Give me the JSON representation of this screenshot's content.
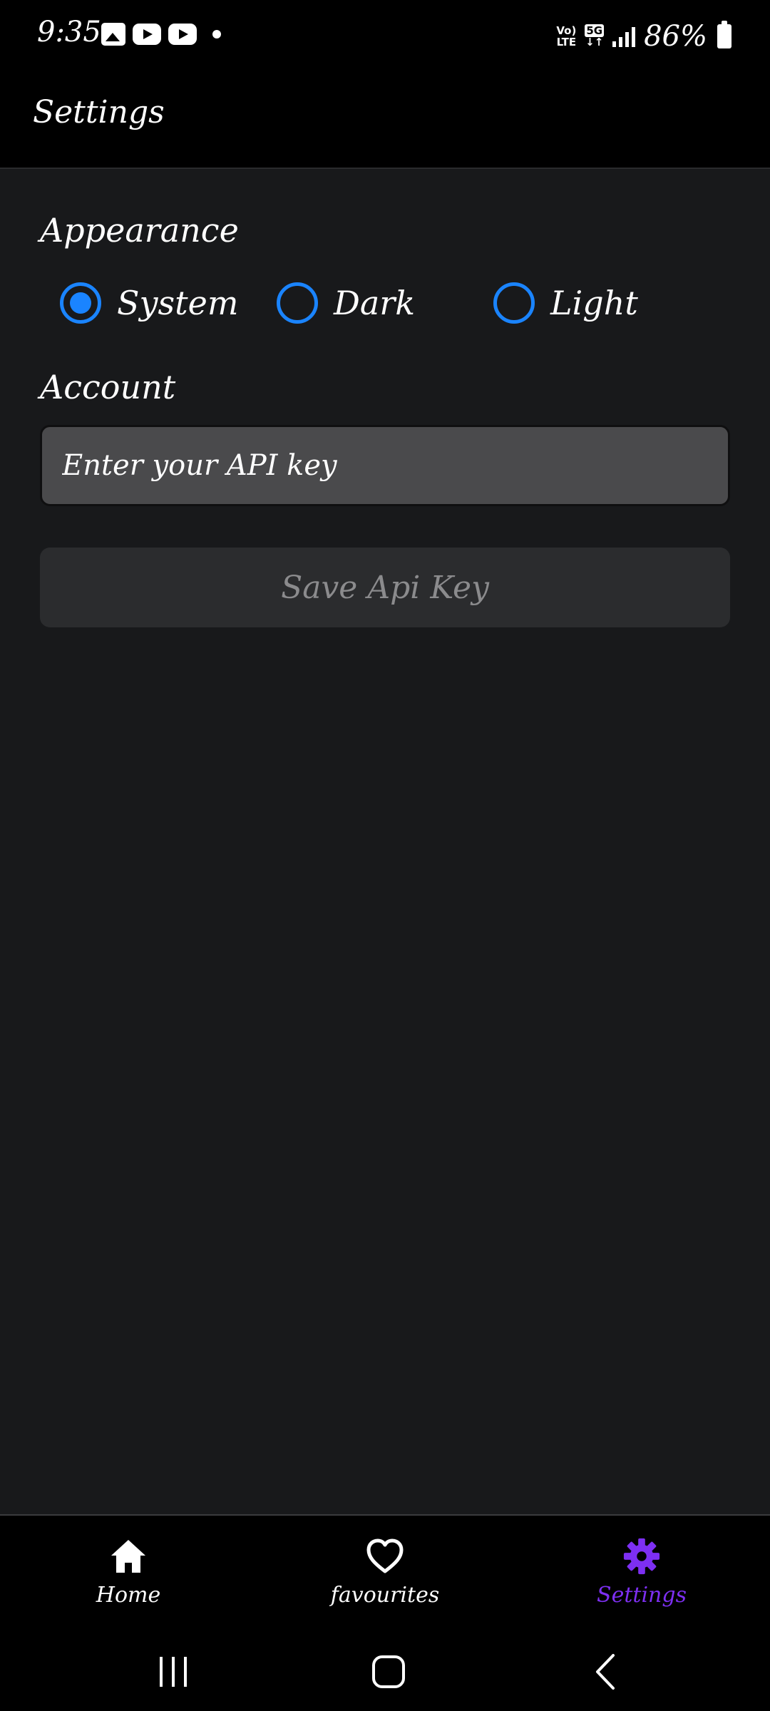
{
  "status_bar": {
    "time": "9:35",
    "left_icons": [
      "gallery-icon",
      "youtube-icon",
      "youtube-icon",
      "dot-icon"
    ],
    "volte": "Vo) LTE",
    "network": "5G",
    "battery": "86%"
  },
  "appbar": {
    "title": "Settings"
  },
  "appearance": {
    "label": "Appearance",
    "options": [
      {
        "label": "System",
        "selected": true
      },
      {
        "label": "Dark",
        "selected": false
      },
      {
        "label": "Light",
        "selected": false
      }
    ]
  },
  "account": {
    "label": "Account",
    "api_placeholder": "Enter your API key",
    "api_value": "",
    "save_label": "Save Api Key"
  },
  "bottom_nav": {
    "items": [
      {
        "label": "Home",
        "icon": "home-icon",
        "active": false
      },
      {
        "label": "favourites",
        "icon": "heart-icon",
        "active": false
      },
      {
        "label": "Settings",
        "icon": "gear-icon",
        "active": true
      }
    ]
  },
  "colors": {
    "background": "#18191b",
    "bar": "#000000",
    "radio_accent": "#1a84ff",
    "nav_active": "#7d2ff2",
    "input_bg": "#4a4a4c",
    "button_bg": "#2b2c2e",
    "button_text": "#8b8b8d"
  }
}
